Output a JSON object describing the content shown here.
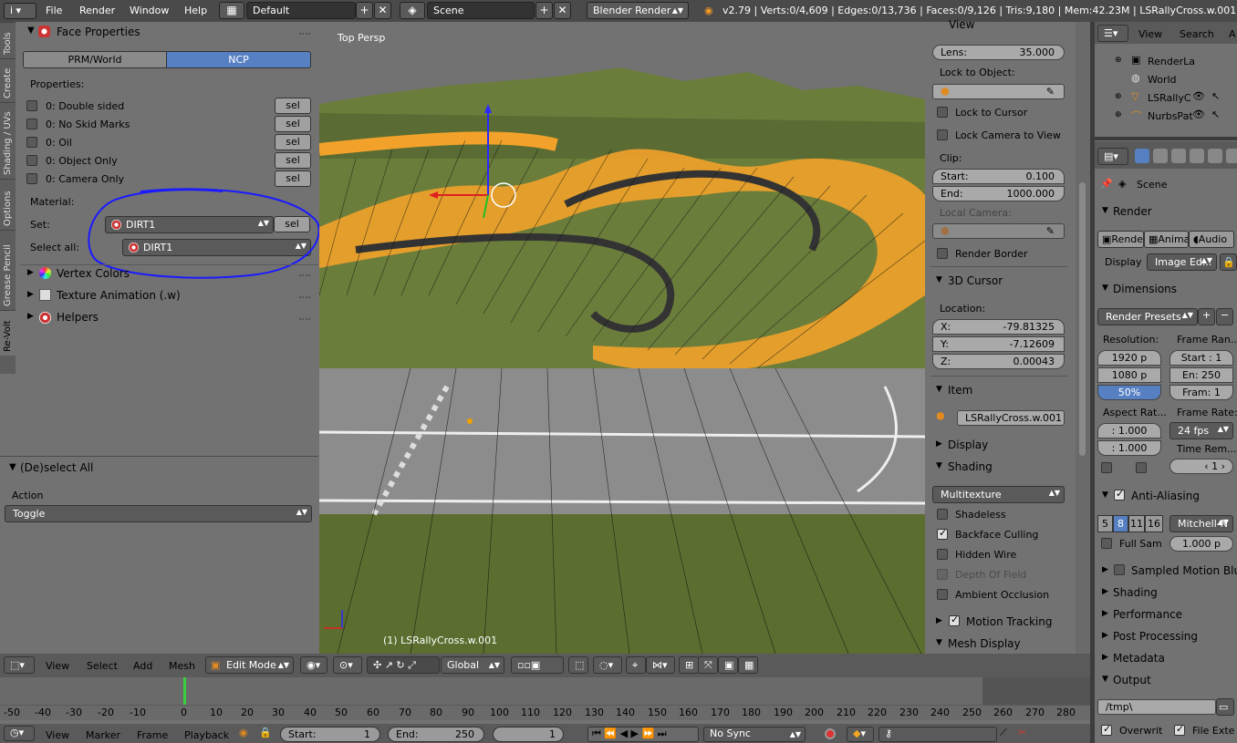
{
  "topbar": {
    "info_icon": "i",
    "menus": [
      "File",
      "Render",
      "Window",
      "Help"
    ],
    "screen_layout": "Default",
    "scene": "Scene",
    "engine": "Blender Render",
    "stats": "v2.79 | Verts:0/4,609 | Edges:0/13,736 | Faces:0/9,126 | Tris:9,180 | Mem:42.23M | LSRallyCross.w.001"
  },
  "toolshelf_tabs": [
    "Tools",
    "Create",
    "Shading / UVs",
    "Options",
    "Grease Pencil",
    "Re-Volt"
  ],
  "face_props": {
    "title": "Face Properties",
    "mode_buttons": [
      "PRM/World",
      "NCP"
    ],
    "active_mode": "NCP",
    "properties_label": "Properties:",
    "properties": [
      {
        "label": "0: Double sided",
        "sel": "sel"
      },
      {
        "label": "0: No Skid Marks",
        "sel": "sel"
      },
      {
        "label": "0: Oil",
        "sel": "sel"
      },
      {
        "label": "0: Object Only",
        "sel": "sel"
      },
      {
        "label": "0: Camera Only",
        "sel": "sel"
      }
    ],
    "material_label": "Material:",
    "set_label": "Set:",
    "set_value": "DIRT1",
    "set_sel": "sel",
    "select_all_label": "Select all:",
    "select_all_value": "DIRT1"
  },
  "subpanels": [
    "Vertex Colors",
    "Texture Animation (.w)",
    "Helpers"
  ],
  "operator": {
    "title": "(De)select All",
    "action_label": "Action",
    "action_value": "Toggle"
  },
  "viewport": {
    "label": "Top Persp",
    "object_label": "(1) LSRallyCross.w.001"
  },
  "npanel": {
    "view_title": "View",
    "lens_label": "Lens:",
    "lens_value": "35.000",
    "lock_to_object": "Lock to Object:",
    "lock_to_cursor": "Lock to Cursor",
    "lock_camera": "Lock Camera to View",
    "clip_label": "Clip:",
    "clip_start_label": "Start:",
    "clip_start": "0.100",
    "clip_end_label": "End:",
    "clip_end": "1000.000",
    "local_camera": "Local Camera:",
    "render_border": "Render Border",
    "cursor_title": "3D Cursor",
    "location_label": "Location:",
    "x_label": "X:",
    "x": "-79.81325",
    "y_label": "Y:",
    "y": "-7.12609",
    "z_label": "Z:",
    "z": "0.00043",
    "item_title": "Item",
    "item_name": "LSRallyCross.w.001",
    "display_title": "Display",
    "shading_title": "Shading",
    "shading_mode": "Multitexture",
    "shading_options": [
      {
        "label": "Shadeless",
        "checked": false,
        "disabled": false
      },
      {
        "label": "Backface Culling",
        "checked": true,
        "disabled": false
      },
      {
        "label": "Hidden Wire",
        "checked": false,
        "disabled": false
      },
      {
        "label": "Depth Of Field",
        "checked": false,
        "disabled": true
      },
      {
        "label": "Ambient Occlusion",
        "checked": false,
        "disabled": false
      }
    ],
    "motion_tracking": "Motion Tracking",
    "mesh_display": "Mesh Display"
  },
  "outliner": {
    "menus": [
      "View",
      "Search",
      "A"
    ],
    "items": [
      "RenderLa",
      "World",
      "LSRallyC",
      "NurbsPat"
    ]
  },
  "properties": {
    "scene": "Scene",
    "render_title": "Render",
    "render_buttons": [
      "Rende",
      "Anima",
      "Audio"
    ],
    "display_label": "Display",
    "display_value": "Image Ed...",
    "dimensions_title": "Dimensions",
    "render_presets": "Render Presets",
    "resolution_label": "Resolution:",
    "res_x": "1920 p",
    "res_y": "1080 p",
    "res_pct": "50%",
    "frame_range_label": "Frame Ran...",
    "frame_start": "Start : 1",
    "frame_end": "En: 250",
    "frame_step": "Fram: 1",
    "aspect_label": "Aspect Rat...",
    "aspect_x": ": 1.000",
    "aspect_y": ": 1.000",
    "frame_rate_label": "Frame Rate:",
    "frame_rate": "24 fps",
    "time_remap_label": "Time Rem...",
    "time_remap_val": "1",
    "aa_title": "Anti-Aliasing",
    "aa_samples": [
      "5",
      "8",
      "11",
      "16"
    ],
    "aa_active": "8",
    "aa_filter": "Mitchell-N",
    "full_sample": "Full Sam",
    "filter_size": "1.000 p",
    "collapsed": [
      "Sampled Motion Blur",
      "Shading",
      "Performance",
      "Post Processing",
      "Metadata"
    ],
    "output_title": "Output",
    "output_path": "/tmp\\",
    "overwrite": "Overwrit",
    "file_ext": "File Exte"
  },
  "view3d_header": {
    "menus": [
      "View",
      "Select",
      "Add",
      "Mesh"
    ],
    "mode": "Edit Mode",
    "orientation": "Global"
  },
  "timeline": {
    "ticks": [
      "-50",
      "-40",
      "-30",
      "-20",
      "-10",
      "0",
      "10",
      "20",
      "30",
      "40",
      "50",
      "60",
      "70",
      "80",
      "90",
      "100",
      "110",
      "120",
      "130",
      "140",
      "150",
      "160",
      "170",
      "180",
      "190",
      "200",
      "210",
      "220",
      "230",
      "240",
      "250",
      "260",
      "270",
      "280"
    ],
    "menus": [
      "View",
      "Marker",
      "Frame",
      "Playback"
    ],
    "start_label": "Start:",
    "start": "1",
    "end_label": "End:",
    "end": "250",
    "current": "1",
    "sync": "No Sync"
  },
  "colors": {
    "accent_blue": "#5680c2",
    "selection_orange": "#f5a623",
    "annotation_blue": "#1a1aff"
  }
}
